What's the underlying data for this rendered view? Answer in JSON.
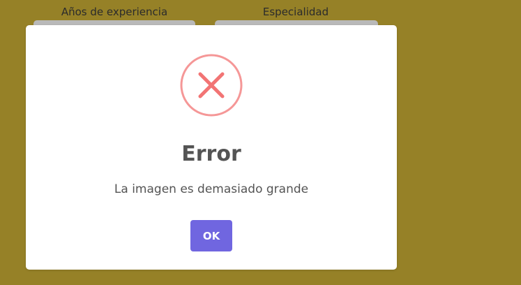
{
  "background_form": {
    "experience_label": "Años de experiencia",
    "specialty_label": "Especialidad"
  },
  "dialog": {
    "icon": "error-x-icon",
    "title": "Error",
    "message": "La imagen es demasiado grande",
    "confirm_label": "OK"
  },
  "colors": {
    "backdrop": "#968127",
    "error_accent": "#f27474",
    "confirm_button": "#7066e0",
    "text": "#545454"
  }
}
